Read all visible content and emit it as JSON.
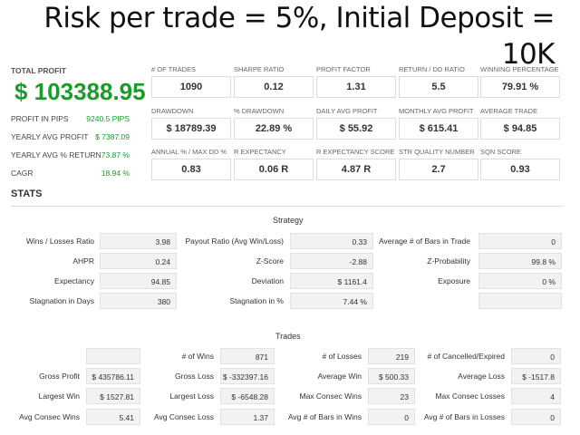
{
  "headline": "Risk per trade = 5%, Initial Deposit = 10K",
  "summary": {
    "total_profit_label": "TOTAL PROFIT",
    "total_profit_value": "$ 103388.95",
    "rows": [
      {
        "label": "PROFIT IN PIPS",
        "value": "9240.5 PIPS"
      },
      {
        "label": "YEARLY AVG PROFIT",
        "value": "$ 7387.09"
      },
      {
        "label": "YEARLY AVG % RETURN",
        "value": "73.87 %"
      },
      {
        "label": "CAGR",
        "value": "18.94 %"
      }
    ],
    "value_color": "#1a9c2a"
  },
  "metrics": [
    {
      "label": "# OF TRADES",
      "value": "1090"
    },
    {
      "label": "SHARPE RATIO",
      "value": "0.12"
    },
    {
      "label": "PROFIT FACTOR",
      "value": "1.31"
    },
    {
      "label": "RETURN / DD RATIO",
      "value": "5.5"
    },
    {
      "label": "WINNING PERCENTAGE",
      "value": "79.91 %"
    },
    {
      "label": "DRAWDOWN",
      "value": "$ 18789.39"
    },
    {
      "label": "% DRAWDOWN",
      "value": "22.89 %"
    },
    {
      "label": "DAILY AVG PROFIT",
      "value": "$ 55.92"
    },
    {
      "label": "MONTHLY AVG PROFIT",
      "value": "$ 615.41"
    },
    {
      "label": "AVERAGE TRADE",
      "value": "$ 94.85"
    },
    {
      "label": "ANNUAL % / MAX DD %",
      "value": "0.83"
    },
    {
      "label": "R EXPECTANCY",
      "value": "0.06 R"
    },
    {
      "label": "R EXPECTANCY SCORE",
      "value": "4.87 R"
    },
    {
      "label": "STR QUALITY NUMBER",
      "value": "2.7"
    },
    {
      "label": "SQN SCORE",
      "value": "0.93"
    }
  ],
  "stats_title": "STATS",
  "strategy": {
    "title": "Strategy",
    "rows": [
      [
        {
          "label": "Wins / Losses Ratio",
          "value": "3.98"
        },
        {
          "label": "Payout Ratio (Avg Win/Loss)",
          "value": "0.33"
        },
        {
          "label": "Average # of Bars in Trade",
          "value": "0"
        }
      ],
      [
        {
          "label": "AHPR",
          "value": "0.24"
        },
        {
          "label": "Z-Score",
          "value": "-2.88"
        },
        {
          "label": "Z-Probability",
          "value": "99.8 %"
        }
      ],
      [
        {
          "label": "Expectancy",
          "value": "94.85"
        },
        {
          "label": "Deviation",
          "value": "$ 1161.4"
        },
        {
          "label": "Exposure",
          "value": "0 %"
        }
      ],
      [
        {
          "label": "Stagnation in Days",
          "value": "380"
        },
        {
          "label": "Stagnation in %",
          "value": "7.44 %"
        },
        {
          "label": "",
          "value": ""
        }
      ]
    ]
  },
  "trades": {
    "title": "Trades",
    "rows": [
      [
        {
          "label": "",
          "value": ""
        },
        {
          "label": "# of Wins",
          "value": "871"
        },
        {
          "label": "# of Losses",
          "value": "219"
        },
        {
          "label": "# of Cancelled/Expired",
          "value": "0"
        }
      ],
      [
        {
          "label": "Gross Profit",
          "value": "$ 435786.11"
        },
        {
          "label": "Gross Loss",
          "value": "$ -332397.16"
        },
        {
          "label": "Average Win",
          "value": "$ 500.33"
        },
        {
          "label": "Average Loss",
          "value": "$ -1517.8"
        }
      ],
      [
        {
          "label": "Largest Win",
          "value": "$ 1527.81"
        },
        {
          "label": "Largest Loss",
          "value": "$ -6548.28"
        },
        {
          "label": "Max Consec Wins",
          "value": "23"
        },
        {
          "label": "Max Consec Losses",
          "value": "4"
        }
      ],
      [
        {
          "label": "Avg Consec Wins",
          "value": "5.41"
        },
        {
          "label": "Avg Consec Loss",
          "value": "1.37"
        },
        {
          "label": "Avg # of Bars in Wins",
          "value": "0"
        },
        {
          "label": "Avg # of Bars in Losses",
          "value": "0"
        }
      ]
    ]
  }
}
